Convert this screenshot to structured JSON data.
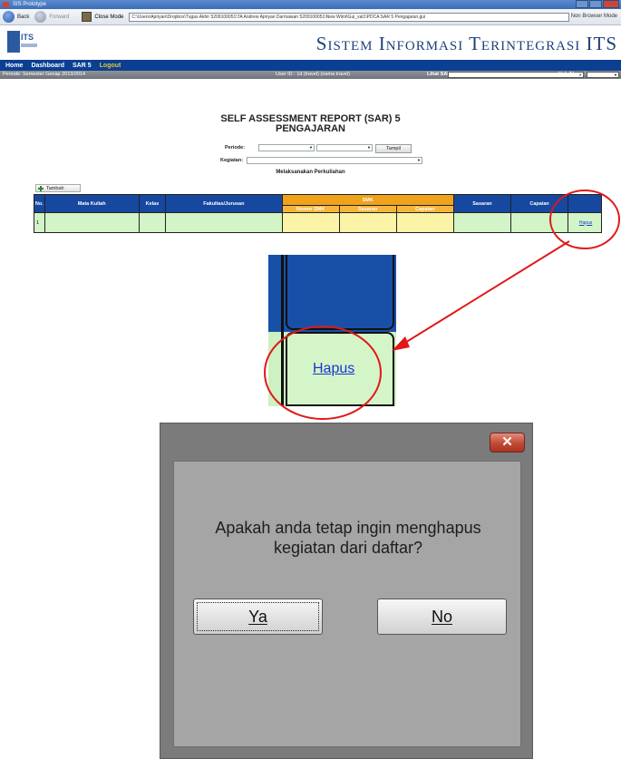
{
  "window": {
    "title": "SIS Prototype"
  },
  "browser": {
    "back_label": "Back",
    "forward_label": "Forward",
    "close_mode_label": "Close Mode",
    "address": "C:\\Users\\Apriyan\\Dropbox\\Tugas Akhir 5209100051\\TA Andrew Apriyan Darmawan 5209100051\\New Wiint\\Gui_val1\\PDCA SAR 5 Pengajaran.gui",
    "non_browser_label": "Non Browser Mode"
  },
  "header": {
    "site_title": "Sistem Informasi Terintegrasi ITS",
    "logo_text": "ITS"
  },
  "menu": {
    "items": [
      "Home",
      "Dashboard",
      "SAR 5"
    ],
    "logout": "Logout"
  },
  "infobar": {
    "period": "Periode: Semester Genap 2013/2014",
    "user": "User ID : 1d (travel)   (nama travel)",
    "lihat_sar": "Lihat SAR :",
    "hak_akses": "Hak Akses :"
  },
  "sar": {
    "title_line1": "SELF ASSESSMENT REPORT (SAR) 5",
    "title_line2": "PENGAJARAN",
    "periode_label": "Periode:",
    "kegiatan_label": "Kegiatan:",
    "tampil_label": "Tampil",
    "subheading": "Melaksanakan Perkuliahan",
    "tambah_label": "Tambah",
    "columns": [
      "No.",
      "Mata Kuliah",
      "Kelas",
      "Fakultas/Jurusan",
      "SMK",
      "Sasaran",
      "Capaian",
      ""
    ],
    "smk_columns": [
      "Nomor SMK",
      "Sasaran",
      "Capaian"
    ],
    "row": {
      "no": "1",
      "action": "Hapus"
    }
  },
  "zoom": {
    "link": "Hapus"
  },
  "dialog": {
    "close_glyph": "✕",
    "message_line1": "Apakah anda tetap ingin menghapus",
    "message_line2": "kegiatan dari daftar?",
    "yes_label": "Ya",
    "no_label": "No"
  },
  "colors": {
    "menu_blue": "#0a3f91",
    "table_header_blue": "#1648a0",
    "smk_orange": "#f0a21a",
    "row_green": "#d2f4c6",
    "annotation_red": "#e01818",
    "dialog_gray": "#7b7b7b"
  }
}
